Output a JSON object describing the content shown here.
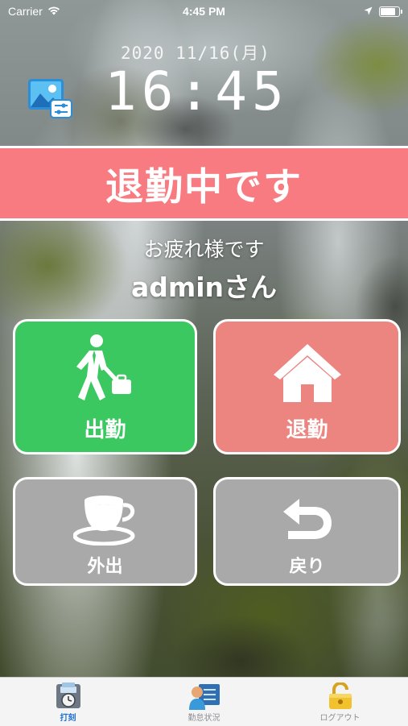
{
  "status_bar": {
    "carrier": "Carrier",
    "time": "4:45 PM",
    "icons": [
      "wifi-icon",
      "location-arrow-icon",
      "battery-icon"
    ]
  },
  "clock": {
    "date": "2020 11/16(月)",
    "time": "16:45"
  },
  "background_settings": {
    "icon": "image-settings-icon"
  },
  "status_banner": {
    "text": "退勤中です",
    "color": "#f77b80"
  },
  "greeting": {
    "message": "お疲れ様です",
    "user": "adminさん"
  },
  "actions": [
    {
      "id": "clock-in",
      "label": "出勤",
      "icon": "businessman-walking-icon",
      "color": "#3cc861"
    },
    {
      "id": "clock-out",
      "label": "退勤",
      "icon": "home-icon",
      "color": "#ec8480"
    },
    {
      "id": "go-out",
      "label": "外出",
      "icon": "coffee-cup-icon",
      "color": "#a9a9a9"
    },
    {
      "id": "return",
      "label": "戻り",
      "icon": "return-arrow-icon",
      "color": "#a9a9a9"
    }
  ],
  "tabs": [
    {
      "label": "打刻",
      "icon": "punch-clock-icon",
      "active": true
    },
    {
      "label": "勤怠状況",
      "icon": "attendance-status-icon",
      "active": false
    },
    {
      "label": "ログアウト",
      "icon": "padlock-icon",
      "active": false
    }
  ],
  "colors": {
    "accent_tab": "#1f6fd1",
    "button_border": "#ffffff"
  }
}
